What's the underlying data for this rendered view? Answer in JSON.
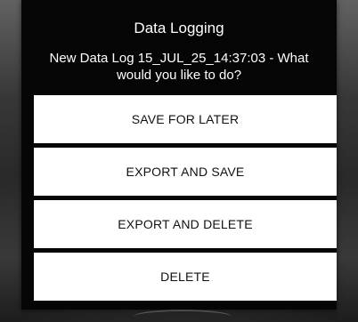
{
  "dialog": {
    "title": "Data Logging",
    "message": "New Data Log 15_JUL_25_14:37:03 - What would you like to do?",
    "buttons": [
      {
        "label": "SAVE FOR LATER"
      },
      {
        "label": "EXPORT AND SAVE"
      },
      {
        "label": "EXPORT AND DELETE"
      },
      {
        "label": "DELETE"
      }
    ]
  },
  "colors": {
    "dialog_background": "#050505",
    "button_background": "#ffffff",
    "button_text": "#111111",
    "title_text": "#ffffff"
  }
}
